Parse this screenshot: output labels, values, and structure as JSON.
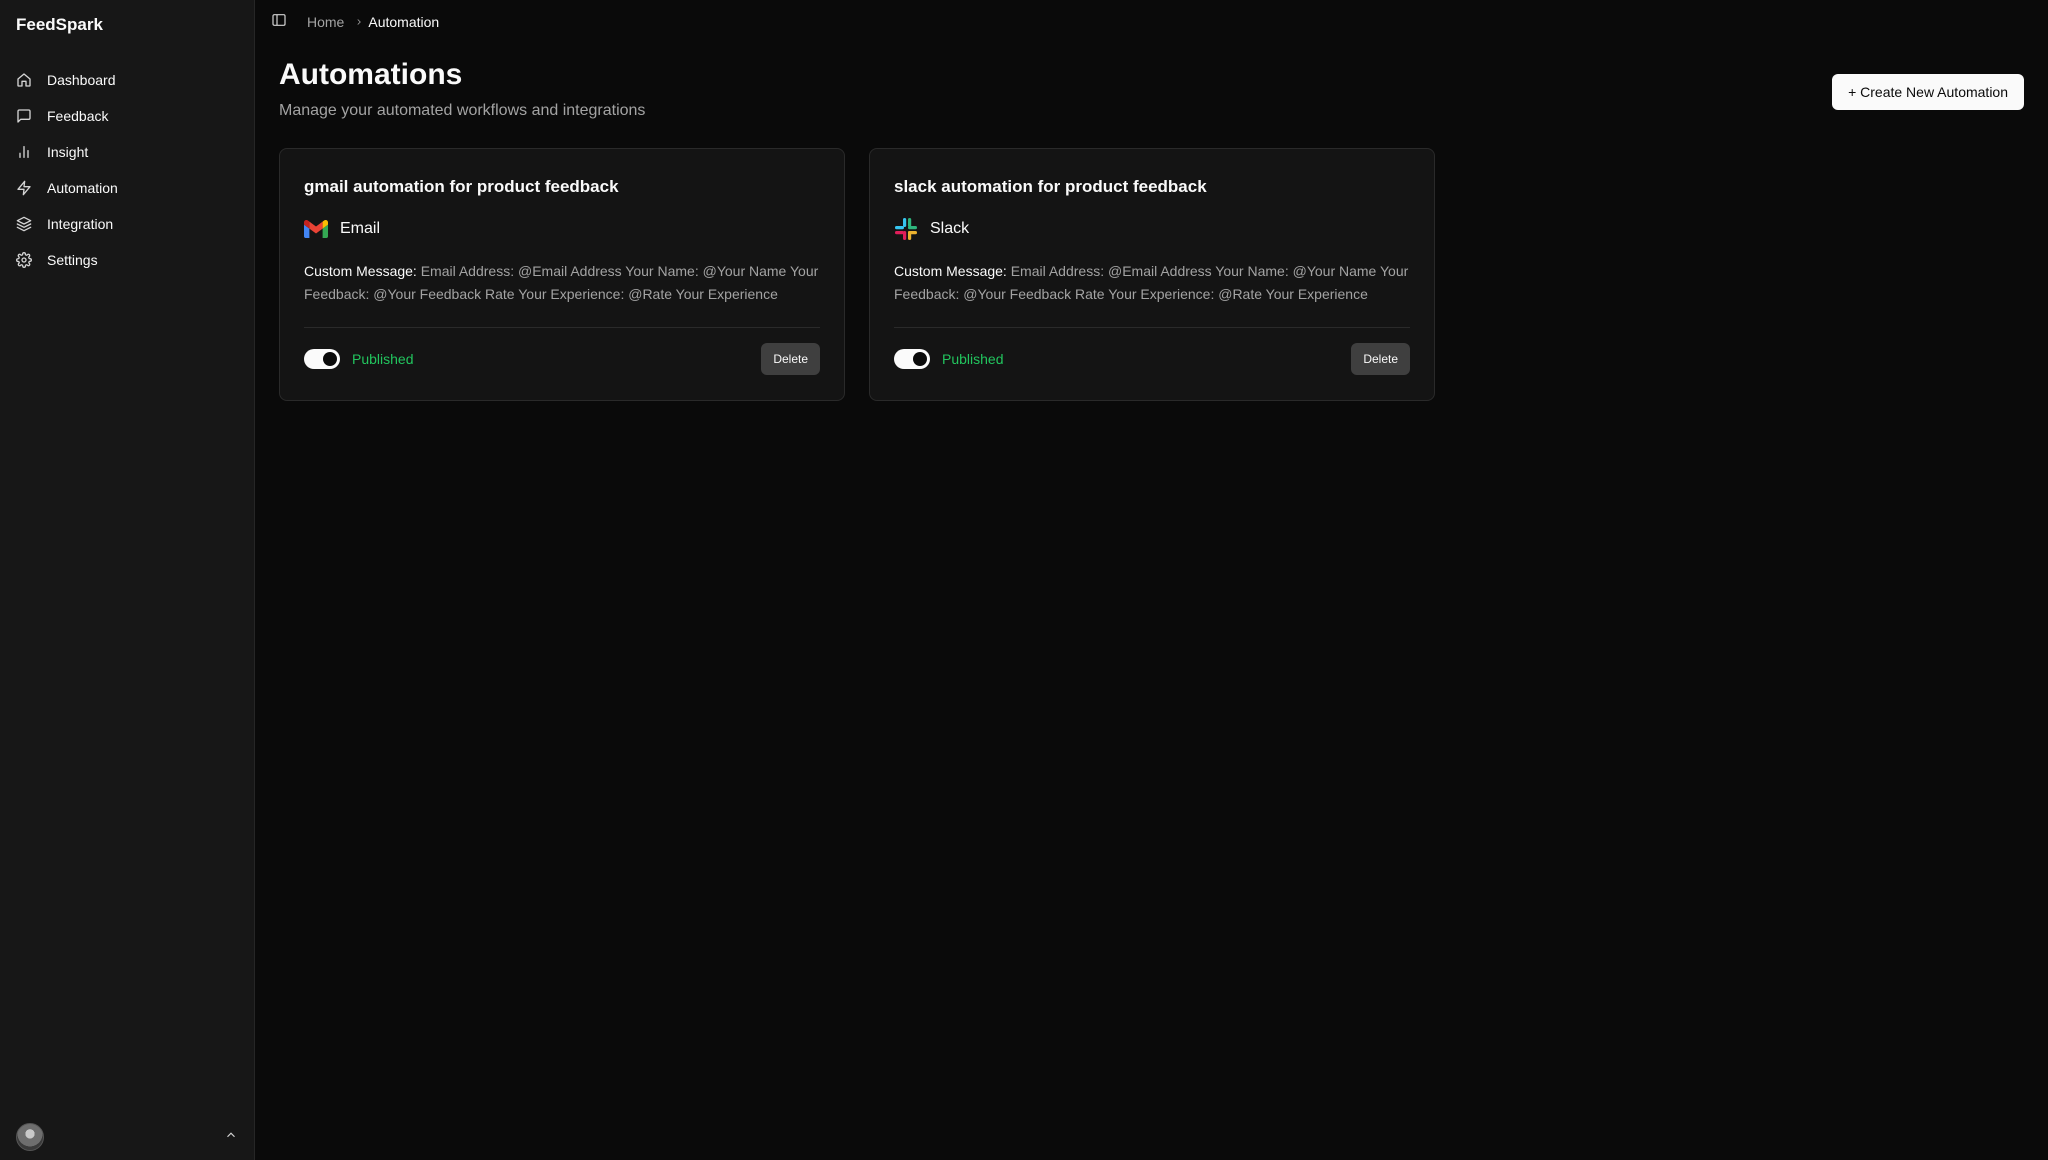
{
  "app": {
    "name": "FeedSpark"
  },
  "sidebar": {
    "items": [
      {
        "label": "Dashboard",
        "icon": "home-icon"
      },
      {
        "label": "Feedback",
        "icon": "message-square-icon"
      },
      {
        "label": "Insight",
        "icon": "bar-chart-icon"
      },
      {
        "label": "Automation",
        "icon": "zap-icon"
      },
      {
        "label": "Integration",
        "icon": "layers-icon"
      },
      {
        "label": "Settings",
        "icon": "gear-icon"
      }
    ]
  },
  "breadcrumb": {
    "home": "Home",
    "current": "Automation"
  },
  "page": {
    "title": "Automations",
    "subtitle": "Manage your automated workflows and integrations",
    "create_button": "+ Create New Automation"
  },
  "automations": [
    {
      "title": "gmail automation for product feedback",
      "service": "Email",
      "service_icon": "gmail-icon",
      "message_label": "Custom Message:",
      "message": "Email Address: @Email Address Your Name: @Your Name Your Feedback: @Your Feedback Rate Your Experience: @Rate Your Experience",
      "status": "Published",
      "enabled": true,
      "delete_label": "Delete"
    },
    {
      "title": "slack automation for product feedback",
      "service": "Slack",
      "service_icon": "slack-icon",
      "message_label": "Custom Message:",
      "message": "Email Address: @Email Address Your Name: @Your Name Your Feedback: @Your Feedback Rate Your Experience: @Rate Your Experience",
      "status": "Published",
      "enabled": true,
      "delete_label": "Delete"
    }
  ],
  "colors": {
    "background": "#0a0a0a",
    "sidebar": "#171717",
    "card": "#141414",
    "published": "#22c55e",
    "primary_button": "#fafafa"
  }
}
